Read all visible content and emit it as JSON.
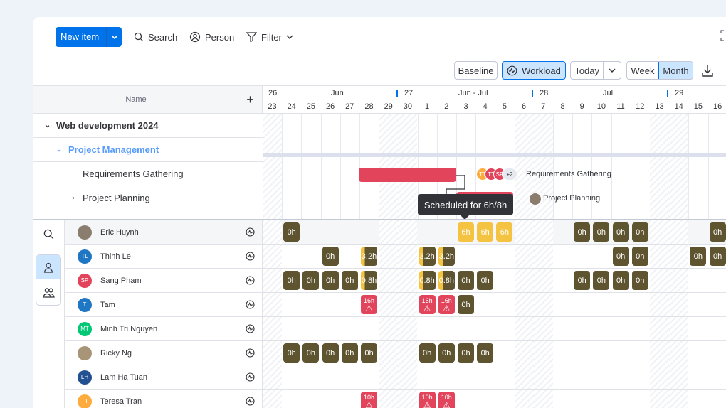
{
  "toolbar": {
    "new_item": "New item",
    "search": "Search",
    "person": "Person",
    "filter": "Filter"
  },
  "controls": {
    "baseline": "Baseline",
    "workload": "Workload",
    "today": "Today",
    "week": "Week",
    "month": "Month",
    "active_view": "Month"
  },
  "table": {
    "name_header": "Name",
    "add_column": "+",
    "group": "Web development 2024",
    "subgroup": "Project Management",
    "items": [
      "Requirements Gathering",
      "Project Planning"
    ]
  },
  "timeline": {
    "week_numbers": [
      "26",
      "27",
      "28",
      "29"
    ],
    "month_labels": [
      "Jun",
      "Jun - Jul",
      "Jul"
    ],
    "days": [
      "23",
      "24",
      "25",
      "26",
      "27",
      "28",
      "29",
      "30",
      "1",
      "2",
      "3",
      "4",
      "5",
      "6",
      "7",
      "8",
      "9",
      "10",
      "11",
      "12",
      "13",
      "14",
      "15",
      "16"
    ]
  },
  "gantt": {
    "req_label": "Requirements Gathering",
    "plan_label": "Project Planning",
    "assignees": [
      "TT",
      "TT",
      "SP"
    ],
    "more_count": "+2",
    "bar_color": "#e2445c"
  },
  "tooltip": "Scheduled for 6h/8h",
  "people": [
    {
      "name": "Eric Huynh",
      "initials": "",
      "color": "#8a7d6e"
    },
    {
      "name": "Thinh Le",
      "initials": "TL",
      "color": "#1f76c2"
    },
    {
      "name": "Sang Pham",
      "initials": "SP",
      "color": "#e2445c"
    },
    {
      "name": "Tam",
      "initials": "T",
      "color": "#1f76c2"
    },
    {
      "name": "Minh Tri Nguyen",
      "initials": "MT",
      "color": "#00c875"
    },
    {
      "name": "Ricky Ng",
      "initials": "",
      "color": "#a89578"
    },
    {
      "name": "Lam Ha Tuan",
      "initials": "LH",
      "color": "#225091"
    },
    {
      "name": "Teresa Tran",
      "initials": "TT",
      "color": "#fdab3d"
    }
  ],
  "workload": [
    [
      {
        "d": 1,
        "t": "0h"
      },
      {
        "d": 10,
        "t": "6h",
        "k": "y"
      },
      {
        "d": 11,
        "t": "6h",
        "k": "y"
      },
      {
        "d": 12,
        "t": "6h",
        "k": "y"
      },
      {
        "d": 16,
        "t": "0h"
      },
      {
        "d": 17,
        "t": "0h"
      },
      {
        "d": 18,
        "t": "0h"
      },
      {
        "d": 19,
        "t": "0h"
      },
      {
        "d": 23,
        "t": "0h"
      }
    ],
    [
      {
        "d": 3,
        "t": "0h"
      },
      {
        "d": 5,
        "t": "3.2h",
        "k": "half"
      },
      {
        "d": 8,
        "t": "3.2h",
        "k": "half"
      },
      {
        "d": 9,
        "t": "3.2h",
        "k": "half"
      },
      {
        "d": 18,
        "t": "0h"
      },
      {
        "d": 19,
        "t": "0h"
      },
      {
        "d": 22,
        "t": "0h"
      },
      {
        "d": 23,
        "t": "0h"
      }
    ],
    [
      {
        "d": 1,
        "t": "0h"
      },
      {
        "d": 2,
        "t": "0h"
      },
      {
        "d": 3,
        "t": "0h"
      },
      {
        "d": 4,
        "t": "0h"
      },
      {
        "d": 5,
        "t": "0.8h",
        "k": "half"
      },
      {
        "d": 8,
        "t": "0.8h",
        "k": "half"
      },
      {
        "d": 9,
        "t": "0.8h",
        "k": "half"
      },
      {
        "d": 10,
        "t": "0h"
      },
      {
        "d": 11,
        "t": "0h"
      },
      {
        "d": 16,
        "t": "0h"
      },
      {
        "d": 17,
        "t": "0h"
      },
      {
        "d": 18,
        "t": "0h"
      },
      {
        "d": 19,
        "t": "0h"
      }
    ],
    [
      {
        "d": 5,
        "t": "16h",
        "k": "r"
      },
      {
        "d": 8,
        "t": "16h",
        "k": "r"
      },
      {
        "d": 9,
        "t": "16h",
        "k": "r"
      },
      {
        "d": 10,
        "t": "0h"
      }
    ],
    [],
    [
      {
        "d": 1,
        "t": "0h"
      },
      {
        "d": 2,
        "t": "0h"
      },
      {
        "d": 3,
        "t": "0h"
      },
      {
        "d": 4,
        "t": "0h"
      },
      {
        "d": 5,
        "t": "0h"
      },
      {
        "d": 8,
        "t": "0h"
      },
      {
        "d": 9,
        "t": "0h"
      },
      {
        "d": 10,
        "t": "0h"
      },
      {
        "d": 11,
        "t": "0h"
      }
    ],
    [],
    [
      {
        "d": 5,
        "t": "10h",
        "k": "r"
      },
      {
        "d": 8,
        "t": "10h",
        "k": "r"
      },
      {
        "d": 9,
        "t": "10h",
        "k": "r"
      }
    ]
  ]
}
